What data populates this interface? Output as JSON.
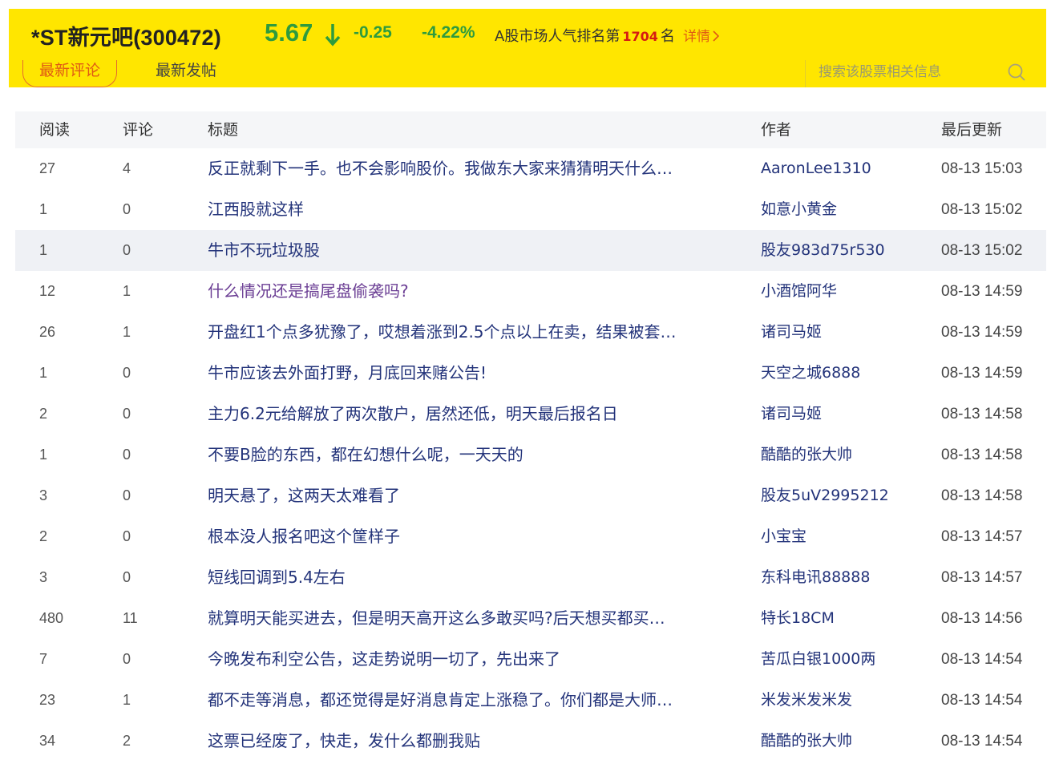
{
  "header": {
    "title": "*ST新元吧(300472)",
    "price": "5.67",
    "change": "-0.25",
    "change_pct": "-4.22%",
    "rank_prefix": "A股市场人气排名第",
    "rank_value": "1704",
    "rank_suffix": "名",
    "detail_link": "详情",
    "price_color": "#2e9b3e",
    "background": "#ffe600"
  },
  "tabs": [
    {
      "label": "最新评论",
      "active": true
    },
    {
      "label": "最新发帖",
      "active": false
    }
  ],
  "search": {
    "placeholder": "搜索该股票相关信息",
    "value": ""
  },
  "table": {
    "headers": {
      "read": "阅读",
      "comments": "评论",
      "title": "标题",
      "author": "作者",
      "updated": "最后更新"
    },
    "rows": [
      {
        "read": "27",
        "comments": "4",
        "title": "反正就剩下一手。也不会影响股价。我做东大家来猜猜明天什么…",
        "author": "AaronLee1310",
        "updated": "08-13 15:03"
      },
      {
        "read": "1",
        "comments": "0",
        "title": "江西股就这样",
        "author": "如意小黄金",
        "updated": "08-13 15:02"
      },
      {
        "read": "1",
        "comments": "0",
        "title": "牛市不玩垃圾股",
        "author": "股友983d75r530",
        "updated": "08-13 15:02",
        "highlighted": true
      },
      {
        "read": "12",
        "comments": "1",
        "title": "什么情况还是搞尾盘偷袭吗?",
        "author": "小酒馆阿华",
        "updated": "08-13 14:59",
        "visited": true
      },
      {
        "read": "26",
        "comments": "1",
        "title": "开盘红1个点多犹豫了，哎想着涨到2.5个点以上在卖，结果被套…",
        "author": "诸司马姬",
        "updated": "08-13 14:59"
      },
      {
        "read": "1",
        "comments": "0",
        "title": "牛市应该去外面打野，月底回来赌公告!",
        "author": "天空之城6888",
        "updated": "08-13 14:59"
      },
      {
        "read": "2",
        "comments": "0",
        "title": "主力6.2元给解放了两次散户，居然还低，明天最后报名日",
        "author": "诸司马姬",
        "updated": "08-13 14:58"
      },
      {
        "read": "1",
        "comments": "0",
        "title": "不要B脸的东西，都在幻想什么呢，一天天的",
        "author": "酷酷的张大帅",
        "updated": "08-13 14:58"
      },
      {
        "read": "3",
        "comments": "0",
        "title": "明天悬了，这两天太难看了",
        "author": "股友5uV2995212",
        "updated": "08-13 14:58"
      },
      {
        "read": "2",
        "comments": "0",
        "title": "根本没人报名吧这个筐样子",
        "author": "小宝宝",
        "updated": "08-13 14:57"
      },
      {
        "read": "3",
        "comments": "0",
        "title": "短线回调到5.4左右",
        "author": "东科电讯88888",
        "updated": "08-13 14:57"
      },
      {
        "read": "480",
        "comments": "11",
        "title": "就算明天能买进去，但是明天高开这么多敢买吗?后天想买都买…",
        "author": "特长18CM",
        "updated": "08-13 14:56"
      },
      {
        "read": "7",
        "comments": "0",
        "title": "今晚发布利空公告，这走势说明一切了，先出来了",
        "author": "苦瓜白银1000两",
        "updated": "08-13 14:54"
      },
      {
        "read": "23",
        "comments": "1",
        "title": "都不走等消息，都还觉得是好消息肯定上涨稳了。你们都是大师…",
        "author": "米发米发米发",
        "updated": "08-13 14:54"
      },
      {
        "read": "34",
        "comments": "2",
        "title": "这票已经废了，快走，发什么都删我贴",
        "author": "酷酷的张大帅",
        "updated": "08-13 14:54"
      }
    ]
  }
}
